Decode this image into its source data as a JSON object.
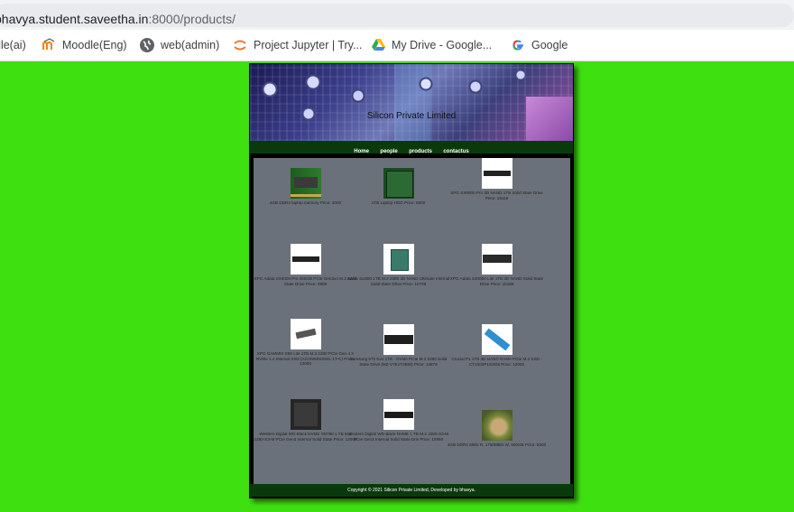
{
  "browser": {
    "url_host": "bhavya.student.saveetha.in",
    "url_path": ":8000/products/",
    "bookmarks": [
      {
        "label": "dle(ai)"
      },
      {
        "label": "Moodle(Eng)"
      },
      {
        "label": "web(admin)"
      },
      {
        "label": "Project Jupyter | Try..."
      },
      {
        "label": "My Drive - Google..."
      },
      {
        "label": "Google"
      }
    ]
  },
  "site": {
    "title": "Silicon Private Limited",
    "nav": [
      "Home",
      "people",
      "products",
      "contactus"
    ],
    "footer": "Copyright © 2021 Silicon Private Limited, Developed by bhavya."
  },
  "products": [
    {
      "text": "4GB DDR4 laptop memory Price: 3000",
      "thumb": "ram"
    },
    {
      "text": "1TB Laptop HDD Price: 5000",
      "thumb": "hdd"
    },
    {
      "text": "XPG SX6000 Pro 3D NAND 1TB Solid State Drive Price: 15119",
      "thumb": "ssd-black"
    },
    {
      "text": "XPG Adata SX6000 Pro 256GB PCIe Gen3x4 M.2 Solid State Drive Price: 3909",
      "thumb": "ssd-black"
    },
    {
      "text": "Adata SU800 1TB M.2 2280 3D NAND Ultimate Internal Solid State Drive Price: 10739",
      "thumb": "ssd-green"
    },
    {
      "text": "XPG Adata S40000 Lite 1TB 3D NAND Solid State Drive Price: 10189",
      "thumb": "ssd-black"
    },
    {
      "text": "XPG GAMMIX S50 Lite 1TB M.2 2280 PCIe Gen 4 X NVMe 1.4 Internal SSD (AGAMMIXS50L-1T-C) Price: 13000",
      "thumb": "ssd-small"
    },
    {
      "text": "Samsung 970 Evo 1TB - NVMe PCIe M.2 2280 Solid State Drive (MZ-V7E1T0BW) Price: 14879",
      "thumb": "ssd-black"
    },
    {
      "text": "Crucial P1 1TB 3D NAND NVMe PCIe M.2 SSD - CT1000P1SSD8 Price: 12000",
      "thumb": "ssd-blue"
    },
    {
      "text": "Western Digital WD Black NVME SN750 1 TB M.2 2280-S3-M PCIe Gen3 Internal Solid State Price: 12000",
      "thumb": "dark"
    },
    {
      "text": "Western Digital WD Black NVME 1 TB M.2 2280-S3-M PCIe Gen3 Internal Solid State Driv Price: 10860",
      "thumb": "ssd-black"
    },
    {
      "text": "4GB DDR4 MB/s R, 1750MB/s W, 500GB Price: 5000",
      "thumb": "photo"
    }
  ]
}
